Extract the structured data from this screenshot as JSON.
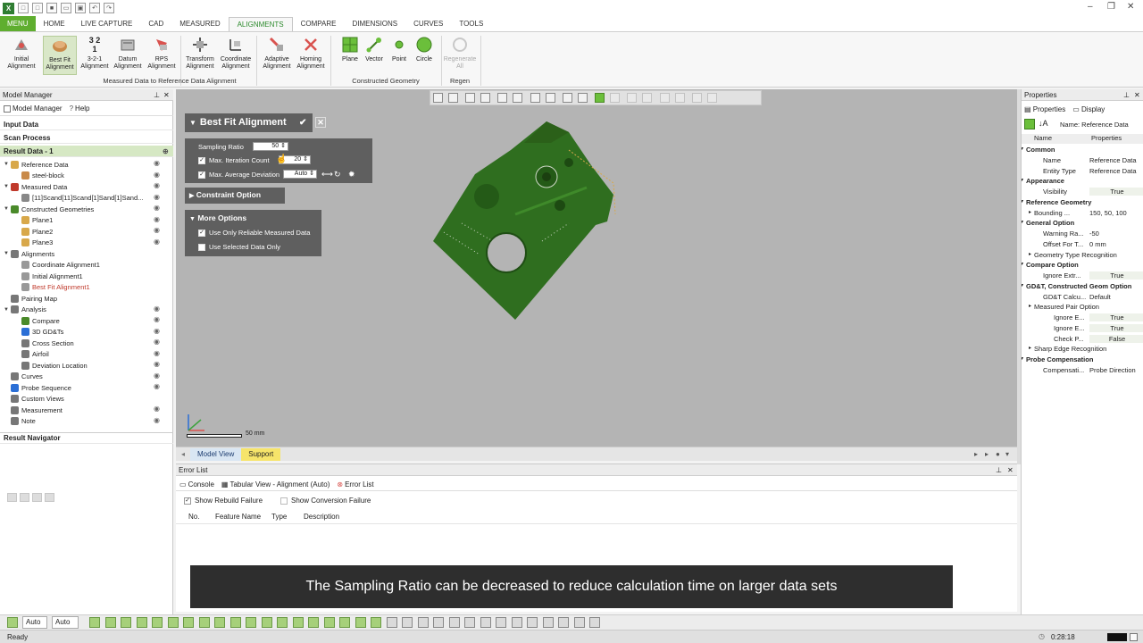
{
  "menu": {
    "main": "MENU",
    "tabs": [
      "HOME",
      "LIVE CAPTURE",
      "CAD",
      "MEASURED",
      "ALIGNMENTS",
      "COMPARE",
      "DIMENSIONS",
      "CURVES",
      "TOOLS"
    ]
  },
  "ribbon": {
    "buttons": [
      {
        "label": "Initial Alignment"
      },
      {
        "label": "Best Fit Alignment"
      },
      {
        "label": "3-2-1 Alignment",
        "icon_text": "3 2 1"
      },
      {
        "label": "Datum Alignment"
      },
      {
        "label": "RPS Alignment"
      },
      {
        "label": "Transform Alignment"
      },
      {
        "label": "Coordinate Alignment"
      },
      {
        "label": "Adaptive Alignment"
      },
      {
        "label": "Homing Alignment"
      },
      {
        "label": "Plane"
      },
      {
        "label": "Vector"
      },
      {
        "label": "Point"
      },
      {
        "label": "Circle"
      },
      {
        "label": "Regenerate All"
      }
    ],
    "groups": [
      "Measured Data to Reference Data Alignment",
      "Constructed Geometry",
      "Regen"
    ]
  },
  "model_manager": {
    "title": "Model Manager",
    "tabs": {
      "model": "Model Manager",
      "help": "Help"
    },
    "sections": {
      "input": "Input Data",
      "scan": "Scan Process",
      "result": "Result Data - 1",
      "navigator": "Result Navigator"
    },
    "tree": [
      {
        "label": "Reference Data"
      },
      {
        "label": "steel-block"
      },
      {
        "label": "Measured Data"
      },
      {
        "label": "[11]Scand[11]Scand[1]Sand[1]Sand..."
      },
      {
        "label": "Constructed Geometries"
      },
      {
        "label": "Plane1"
      },
      {
        "label": "Plane2"
      },
      {
        "label": "Plane3"
      },
      {
        "label": "Alignments"
      },
      {
        "label": "Coordinate Alignment1"
      },
      {
        "label": "Initial Alignment1"
      },
      {
        "label": "Best Fit Alignment1"
      },
      {
        "label": "Pairing Map"
      },
      {
        "label": "Analysis"
      },
      {
        "label": "Compare"
      },
      {
        "label": "3D GD&Ts"
      },
      {
        "label": "Cross Section"
      },
      {
        "label": "Airfoil"
      },
      {
        "label": "Deviation Location"
      },
      {
        "label": "Curves"
      },
      {
        "label": "Probe Sequence"
      },
      {
        "label": "Custom Views"
      },
      {
        "label": "Measurement"
      },
      {
        "label": "Note"
      }
    ]
  },
  "viewport": {
    "panel_title": "Best Fit Alignment",
    "sampling_label": "Sampling Ratio",
    "sampling_value": "50",
    "max_iter_label": "Max. Iteration Count",
    "max_iter_value": "20",
    "max_iter_checked": true,
    "max_avg_label": "Max. Average Deviation",
    "max_avg_value": "Auto",
    "max_avg_checked": true,
    "constraint_label": "Constraint Option",
    "more_label": "More Options",
    "use_reliable_label": "Use Only Reliable Measured Data",
    "use_reliable_checked": true,
    "use_selected_label": "Use Selected Data Only",
    "use_selected_checked": false,
    "scale_label": "50 mm",
    "part_color": "#2f6e1f",
    "tabs": {
      "model": "Model View",
      "support": "Support"
    }
  },
  "error_list": {
    "title": "Error List",
    "tabs": [
      "Console",
      "Tabular View - Alignment (Auto)",
      "Error List"
    ],
    "show_rebuild": "Show Rebuild Failure",
    "show_conversion": "Show Conversion Failure",
    "columns": [
      "No.",
      "Feature Name",
      "Type",
      "Description"
    ]
  },
  "subtitle": "The Sampling Ratio can be decreased to reduce calculation time on larger data sets",
  "properties": {
    "title": "Properties",
    "tabs": {
      "properties": "Properties",
      "display": "Display"
    },
    "name_label": "Name: Reference Data",
    "header": {
      "name": "Name",
      "properties": "Properties"
    },
    "rows": [
      {
        "type": "cat",
        "key": "Common"
      },
      {
        "type": "row",
        "key": "Name",
        "value": "Reference Data"
      },
      {
        "type": "row",
        "key": "Entity Type",
        "value": "Reference Data"
      },
      {
        "type": "cat",
        "key": "Appearance"
      },
      {
        "type": "row",
        "key": "Visibility",
        "value": "True",
        "box": true
      },
      {
        "type": "cat",
        "key": "Reference Geometry"
      },
      {
        "type": "sub",
        "key": "Bounding ...",
        "value": "150, 50, 100"
      },
      {
        "type": "cat",
        "key": "General Option"
      },
      {
        "type": "row",
        "key": "Warning Ra...",
        "value": "-50"
      },
      {
        "type": "row",
        "key": "Offset For T...",
        "value": "0 mm"
      },
      {
        "type": "sub",
        "key": "Geometry Type Recognition",
        "value": ""
      },
      {
        "type": "cat",
        "key": "Compare Option"
      },
      {
        "type": "row",
        "key": "Ignore Extr...",
        "value": "True",
        "box": true
      },
      {
        "type": "cat",
        "key": "GD&T, Constructed Geom Option"
      },
      {
        "type": "row",
        "key": "GD&T Calcu...",
        "value": "Default"
      },
      {
        "type": "sub",
        "key": "Measured Pair Option",
        "value": ""
      },
      {
        "type": "row2",
        "key": "Ignore E...",
        "value": "True",
        "box": true
      },
      {
        "type": "row2",
        "key": "Ignore E...",
        "value": "True",
        "box": true
      },
      {
        "type": "row2",
        "key": "Check P...",
        "value": "False",
        "box": true
      },
      {
        "type": "sub",
        "key": "Sharp Edge Recognition",
        "value": ""
      },
      {
        "type": "cat",
        "key": "Probe Compensation"
      },
      {
        "type": "row",
        "key": "Compensati...",
        "value": "Probe Direction"
      }
    ]
  },
  "bottom": {
    "select1": "Auto",
    "select2": "Auto"
  },
  "status": {
    "left": "Ready",
    "time": "0:28:18"
  }
}
